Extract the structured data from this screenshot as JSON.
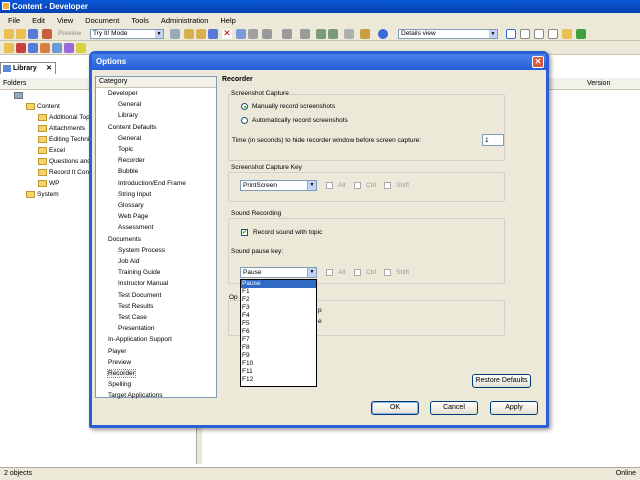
{
  "window": {
    "title": "Content - Developer"
  },
  "menu": [
    "File",
    "Edit",
    "View",
    "Document",
    "Tools",
    "Administration",
    "Help"
  ],
  "toolbar": {
    "preview": "Preview",
    "mode": "Try It! Mode",
    "view": "Details view"
  },
  "library": {
    "tab": "Library",
    "folders_header": "Folders",
    "version_header": "Version",
    "tree": [
      "Content",
      "Additional Top",
      "Attachments",
      "Editing Techni",
      "Excel",
      "Questions and",
      "Record It Con",
      "WP",
      "System"
    ]
  },
  "status": {
    "left": "2 objects",
    "right": "Online"
  },
  "dialog": {
    "title": "Options",
    "category_header": "Category",
    "categories": [
      {
        "label": "Developer",
        "indent": 0
      },
      {
        "label": "General",
        "indent": 1
      },
      {
        "label": "Library",
        "indent": 1
      },
      {
        "label": "Content Defaults",
        "indent": 0
      },
      {
        "label": "General",
        "indent": 1
      },
      {
        "label": "Topic",
        "indent": 1
      },
      {
        "label": "Recorder",
        "indent": 1
      },
      {
        "label": "Bubble",
        "indent": 1
      },
      {
        "label": "Introduction/End Frame",
        "indent": 1
      },
      {
        "label": "String Input",
        "indent": 1
      },
      {
        "label": "Glossary",
        "indent": 1
      },
      {
        "label": "Web Page",
        "indent": 1
      },
      {
        "label": "Assessment",
        "indent": 1
      },
      {
        "label": "Documents",
        "indent": 0
      },
      {
        "label": "System Process",
        "indent": 1
      },
      {
        "label": "Job Aid",
        "indent": 1
      },
      {
        "label": "Training Guide",
        "indent": 1
      },
      {
        "label": "Instructor Manual",
        "indent": 1
      },
      {
        "label": "Test Document",
        "indent": 1
      },
      {
        "label": "Test Results",
        "indent": 1
      },
      {
        "label": "Test Case",
        "indent": 1
      },
      {
        "label": "Presentation",
        "indent": 1
      },
      {
        "label": "In-Application Support",
        "indent": 0
      },
      {
        "label": "Player",
        "indent": 0
      },
      {
        "label": "Preview",
        "indent": 0
      },
      {
        "label": "Recorder",
        "indent": 0
      },
      {
        "label": "Spelling",
        "indent": 0
      },
      {
        "label": "Target Applications",
        "indent": 0
      }
    ],
    "selected_index": 25,
    "section_title": "Recorder",
    "capture": {
      "title": "Screenshot Capture",
      "manual": "Manually record screenshots",
      "auto": "Automatically record screenshots",
      "time_label": "Time (in seconds) to hide recorder window before screen capture:",
      "time_value": "1"
    },
    "capture_key": {
      "title": "Screenshot Capture Key",
      "value": "PrintScreen",
      "alt": "Alt",
      "ctrl": "Ctrl",
      "shift": "Shift"
    },
    "sound": {
      "title": "Sound Recording",
      "record_label": "Record sound with topic",
      "pause_label": "Sound pause key:",
      "pause_value": "Pause",
      "alt": "Alt",
      "ctrl": "Ctrl",
      "shift": "Shift"
    },
    "hidden_group": {
      "title_fragment": "Op",
      "text_fragment_1": "p",
      "text_fragment_2": "e"
    },
    "pause_options": [
      "Pause",
      "F1",
      "F2",
      "F3",
      "F4",
      "F5",
      "F6",
      "F7",
      "F8",
      "F9",
      "F10",
      "F11",
      "F12"
    ],
    "buttons": {
      "restore": "Restore Defaults",
      "ok": "OK",
      "cancel": "Cancel",
      "apply": "Apply"
    }
  }
}
